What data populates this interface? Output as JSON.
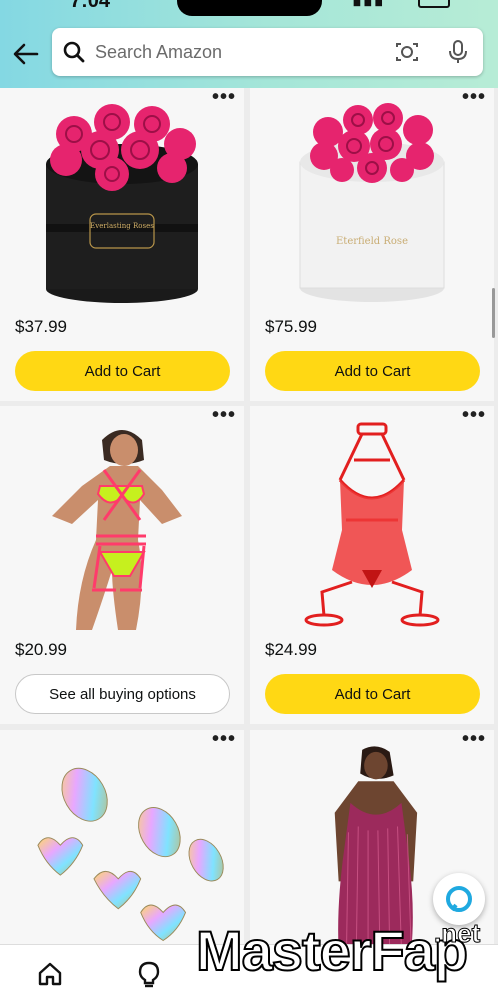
{
  "status": {
    "time": "7:04"
  },
  "search": {
    "placeholder": "Search Amazon"
  },
  "products": [
    {
      "price": "$37.99",
      "button": "Add to Cart",
      "more": "•••",
      "box_text": "Everlasting Roses"
    },
    {
      "price": "$75.99",
      "button": "Add to Cart",
      "more": "•••",
      "box_text": "Eterfield Rose"
    },
    {
      "price": "$20.99",
      "button": "See all buying options",
      "more": "•••"
    },
    {
      "price": "$24.99",
      "button": "Add to Cart",
      "more": "•••"
    },
    {
      "more": "•••"
    },
    {
      "more": "•••"
    }
  ],
  "colors": {
    "accent_yellow": "#ffd814",
    "header_start": "#84d8e3",
    "header_end": "#b7ecd6",
    "rose_pink": "#e6246e"
  },
  "watermark": {
    "main": "MasterFap",
    "suffix": ".net"
  },
  "icons": [
    "back-arrow-icon",
    "search-icon",
    "camera-icon",
    "mic-icon",
    "home-icon",
    "lightbulb-icon",
    "alexa-icon"
  ]
}
